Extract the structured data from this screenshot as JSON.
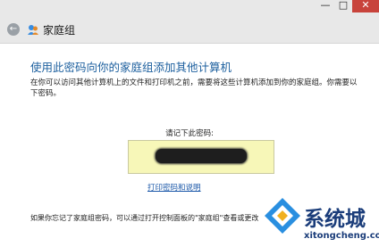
{
  "window": {
    "minimize_glyph": "—",
    "maximize_glyph": "□",
    "close_glyph": "✕"
  },
  "nav": {
    "back_glyph": "←",
    "title": "家庭组",
    "icon": "homegroup-icon"
  },
  "main": {
    "heading": "使用此密码向你的家庭组添加其他计算机",
    "description": "在你可以访问其他计算机上的文件和打印机之前，需要将这些计算机添加到你的家庭组。你需要以下密码。",
    "password_label": "请记下此密码:",
    "print_link": "打印密码和说明",
    "footer": "如果你忘记了家庭组密码，可以通过打开控制面板的\"家庭组\"查看或更改"
  },
  "watermark": {
    "brand": "系统城",
    "domain": "xitongcheng.com",
    "icon": "xitongcheng-logo-icon"
  },
  "colors": {
    "heading": "#1c5f9e",
    "link": "#1a57a8",
    "password_box": "#f7f7b8",
    "close_button": "#c8433b",
    "watermark": "#1b3d7a"
  }
}
